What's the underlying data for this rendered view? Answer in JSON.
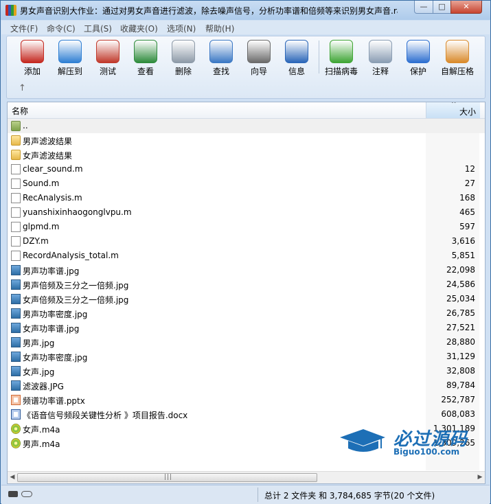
{
  "window": {
    "title": "男女声音识别大作业：通过对男女声音进行滤波，除去噪声信号，分析功率谱和倍频等来识别男女声音.rar...",
    "controls": {
      "minimize": "—",
      "maximize": "□",
      "close": "✕"
    }
  },
  "menu": [
    "文件(F)",
    "命令(C)",
    "工具(S)",
    "收藏夹(O)",
    "选项(N)",
    "帮助(H)"
  ],
  "toolbar": [
    {
      "label": "添加",
      "icon": "add-archive-icon",
      "color": "#c4281f"
    },
    {
      "label": "解压到",
      "icon": "extract-folder-icon",
      "color": "#2f7fd3"
    },
    {
      "label": "测试",
      "icon": "test-clipboard-icon",
      "color": "#c0392b"
    },
    {
      "label": "查看",
      "icon": "view-book-icon",
      "color": "#2e8b3c"
    },
    {
      "label": "删除",
      "icon": "delete-trash-icon",
      "color": "#8d9aa8"
    },
    {
      "label": "查找",
      "icon": "find-magnifier-icon",
      "color": "#3b78c4"
    },
    {
      "label": "向导",
      "icon": "wizard-wand-icon",
      "color": "#6b6b6b"
    },
    {
      "label": "信息",
      "icon": "info-icon",
      "color": "#2a66b8"
    },
    {
      "label": "扫描病毒",
      "icon": "scan-virus-icon",
      "color": "#3fa535"
    },
    {
      "label": "注释",
      "icon": "comment-icon",
      "color": "#8a9db3"
    },
    {
      "label": "保护",
      "icon": "protect-shield-icon",
      "color": "#2d6fd0"
    },
    {
      "label": "自解压格",
      "icon": "sfx-box-icon",
      "color": "#d98a2b"
    }
  ],
  "up_arrow": "↑",
  "columns": {
    "name": "名称",
    "size": "大小",
    "sort_indicator": "^"
  },
  "files": [
    {
      "name": "..",
      "size": "",
      "type": "parent"
    },
    {
      "name": "男声滤波结果",
      "size": "",
      "type": "folder"
    },
    {
      "name": "女声滤波结果",
      "size": "",
      "type": "folder"
    },
    {
      "name": "clear_sound.m",
      "size": "12",
      "type": "file"
    },
    {
      "name": "Sound.m",
      "size": "27",
      "type": "file"
    },
    {
      "name": "RecAnalysis.m",
      "size": "168",
      "type": "file"
    },
    {
      "name": "yuanshixinhaogonglvpu.m",
      "size": "465",
      "type": "file"
    },
    {
      "name": "glpmd.m",
      "size": "597",
      "type": "file"
    },
    {
      "name": "DZY.m",
      "size": "3,616",
      "type": "file"
    },
    {
      "name": "RecordAnalysis_total.m",
      "size": "5,851",
      "type": "file"
    },
    {
      "name": "男声功率谱.jpg",
      "size": "22,098",
      "type": "img"
    },
    {
      "name": "男声倍频及三分之一倍频.jpg",
      "size": "24,586",
      "type": "img"
    },
    {
      "name": "女声倍频及三分之一倍频.jpg",
      "size": "25,034",
      "type": "img"
    },
    {
      "name": "男声功率密度.jpg",
      "size": "26,785",
      "type": "img"
    },
    {
      "name": "女声功率谱.jpg",
      "size": "27,521",
      "type": "img"
    },
    {
      "name": "男声.jpg",
      "size": "28,880",
      "type": "img"
    },
    {
      "name": "女声功率密度.jpg",
      "size": "31,129",
      "type": "img"
    },
    {
      "name": "女声.jpg",
      "size": "32,808",
      "type": "img"
    },
    {
      "name": "滤波器.JPG",
      "size": "89,784",
      "type": "img"
    },
    {
      "name": "频谱功率谱.pptx",
      "size": "252,787",
      "type": "ppt"
    },
    {
      "name": "《语音信号频段关键性分析 》项目报告.docx",
      "size": "608,083",
      "type": "doc"
    },
    {
      "name": "女声.m4a",
      "size": "1,301,189",
      "type": "audio"
    },
    {
      "name": "男声.m4a",
      "size": "1,309,265",
      "type": "audio"
    }
  ],
  "scrollbar": {
    "left": "◀",
    "right": "▶",
    "grip": "|||"
  },
  "status": {
    "summary": "总计 2 文件夹 和 3,784,685 字节(20 个文件)"
  },
  "watermark": {
    "cn": "必过源码",
    "en": "Biguo100.com"
  }
}
